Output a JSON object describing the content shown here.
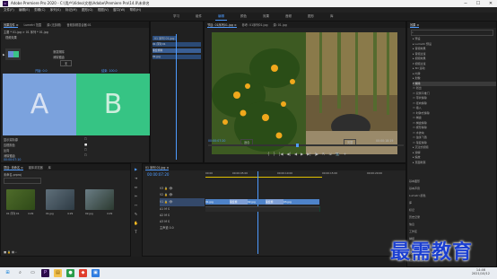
{
  "window": {
    "title": "Adobe Premiere Pro 2020 - C:\\用户\\Video\\文档\\Adobe\\Premiere Pro\\14.0\\未命名",
    "app_icon": "Pr",
    "min_icon": "─",
    "max_icon": "☐",
    "close_icon": "✕"
  },
  "menu": [
    "文件(F)",
    "编辑(E)",
    "剪辑(C)",
    "序列(S)",
    "标记(M)",
    "图形(G)",
    "视图(V)",
    "窗口(W)",
    "帮助(H)"
  ],
  "workspaces": {
    "items": [
      "学习",
      "组件",
      "编辑",
      "颜色",
      "效果",
      "音频",
      "图形",
      "库"
    ],
    "active_index": 2
  },
  "effect_controls": {
    "tabs": [
      "效果控件 ≡",
      "Lumetri 范围",
      "源:(无剪辑)",
      "音频剪辑混合器:01"
    ],
    "clip_header": "主要 * 01.jpg  >  01 序列 * 01.jpg",
    "video_label": "视频效果",
    "ui_label": "渐变擦除",
    "preview_icon": "▶",
    "border_label": "边框宽度",
    "border_value": "0.0",
    "anti_alias_label": "消除锯齿",
    "anti_alias_value": "无",
    "tile_label": "平铺",
    "show_source_label": "显示实际源",
    "reverse_label": "反向",
    "panel_a": "A",
    "panel_b": "B",
    "start_label": "开始: 0.0",
    "end_label": "结束: 100.0",
    "props": [
      {
        "label": "显示实际源",
        "value": "☐"
      },
      {
        "label": "边框颜色",
        "value": "■"
      },
      {
        "label": "反向",
        "value": "☐"
      },
      {
        "label": "消除锯齿",
        "value": "☐"
      }
    ],
    "timecode": "00:00:07:10"
  },
  "mini_timeline": {
    "header": "01 序列 01.jpg",
    "clips": [
      "01 序列 01",
      "渐变擦除",
      "01.jpg"
    ]
  },
  "program": {
    "tabs": [
      "节目: 01序列01.jpg ≡",
      "参考: 01序列01.jpg",
      "源: 01.jpg"
    ],
    "timecode": "00:00:07:20",
    "fit_label": "适合",
    "quality_label": "完整",
    "duration": "00:00:18:19",
    "controls": [
      "{",
      "}",
      "|◀",
      "◀|",
      "◀",
      "▶",
      "▶|",
      "|▶",
      "⇱",
      "⇲",
      "📷",
      "+"
    ]
  },
  "effects_panel": {
    "tabs": [
      "效果 ≡"
    ],
    "search_icon": "⌕",
    "tree": [
      {
        "label": "▸ 预设",
        "selected": false
      },
      {
        "label": "▸ Lumetri 预设",
        "selected": false
      },
      {
        "label": "▸ 音频效果",
        "selected": false
      },
      {
        "label": "▸ 音频过渡",
        "selected": false
      },
      {
        "label": "▸ 视频效果",
        "selected": false
      },
      {
        "label": "▾ 视频过渡",
        "selected": false
      },
      {
        "label": "  ▸ 3D 运动",
        "selected": false
      },
      {
        "label": "  ▸ 内滑",
        "selected": false
      },
      {
        "label": "  ▸ 划像",
        "selected": false
      },
      {
        "label": "  ▾ 擦除",
        "selected": true
      },
      {
        "label": "    ▭ 划出",
        "selected": false
      },
      {
        "label": "    ▭ 双侧平推门",
        "selected": false
      },
      {
        "label": "    ▭ 带状擦除",
        "selected": false
      },
      {
        "label": "    ▭ 径向擦除",
        "selected": false
      },
      {
        "label": "    ▭ 插入",
        "selected": false
      },
      {
        "label": "    ▭ 时钟式擦除",
        "selected": false
      },
      {
        "label": "    ▭ 棋盘",
        "selected": false
      },
      {
        "label": "    ▭ 棋盘擦除",
        "selected": false
      },
      {
        "label": "    ▭ 楔形擦除",
        "selected": false
      },
      {
        "label": "    ▭ 水波块",
        "selected": false
      },
      {
        "label": "    ▭ 油漆飞溅",
        "selected": false
      },
      {
        "label": "    ▭ 渐变擦除",
        "selected": false
      },
      {
        "label": "  ▸ 沉浸式视频",
        "selected": false
      },
      {
        "label": "  ▸ 溶解",
        "selected": false
      },
      {
        "label": "  ▸ 缩放",
        "selected": false
      },
      {
        "label": "  ▸ 页面剥落",
        "selected": false
      }
    ],
    "lower": [
      "基本图形",
      "基本声音",
      "Lumetri 颜色",
      "库",
      "标记",
      "历史记录",
      "信息",
      "工作区",
      "捕捉",
      "进度",
      "元数据",
      "媒体浏览器"
    ]
  },
  "project": {
    "tabs": [
      "项目: 未命名 ≡",
      "媒体浏览器",
      "库"
    ],
    "file": "未命名.prproj",
    "items": [
      {
        "name": "01 序列 01",
        "dur": "4:29"
      },
      {
        "name": "01.jpg",
        "dur": "4:29"
      },
      {
        "name": "02.jpg",
        "dur": "4:29"
      }
    ],
    "status": "■ 🔒 ▦ ⌕"
  },
  "timeline": {
    "tab": "01 序列 01.jpg ≡",
    "timecode": "00:00:07:20",
    "ruler": [
      "00:00",
      "00:00:05:00",
      "00:00:10:00",
      "00:00:15:00",
      "00:00:20:00"
    ],
    "tracks": [
      "V3",
      "V2",
      "V1",
      "A1",
      "A2",
      "A3"
    ],
    "master": "主声道",
    "master_value": "0.0",
    "clips": [
      "01.jpg",
      "渐变擦",
      "02.jpg",
      "渐变擦",
      "03.jpg"
    ]
  },
  "tools": [
    "▶",
    "⇥",
    "⇔",
    "✂",
    "⇿",
    "✎",
    "✋",
    "T"
  ],
  "watermark": "最需教育",
  "taskbar": {
    "time": "14:46",
    "date": "2021/10/12"
  }
}
